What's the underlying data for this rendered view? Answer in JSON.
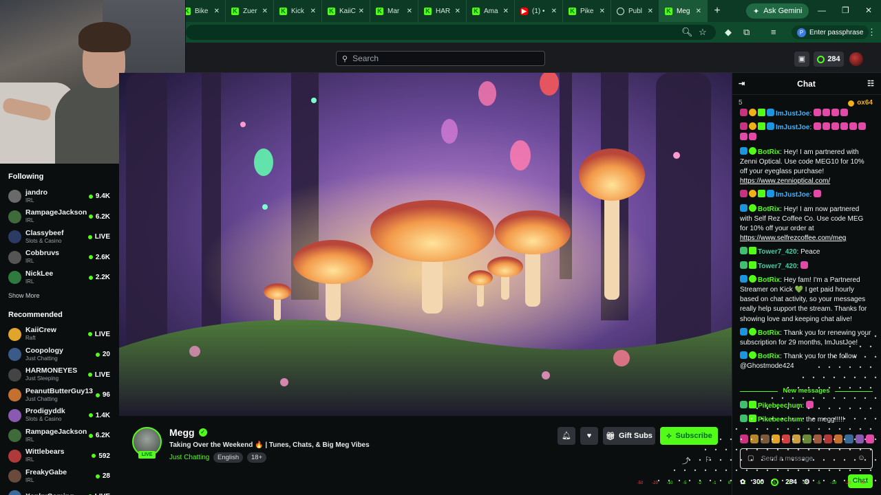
{
  "browser": {
    "tabs": [
      {
        "label": "Bike",
        "icon": "kick-icon"
      },
      {
        "label": "Zuer",
        "icon": "kick-icon"
      },
      {
        "label": "Kick",
        "icon": "kick-icon"
      },
      {
        "label": "KaiiC",
        "icon": "kick-icon"
      },
      {
        "label": "Mar",
        "icon": "kick-icon"
      },
      {
        "label": "HAR",
        "icon": "kick-icon"
      },
      {
        "label": "Ama",
        "icon": "kick-icon"
      },
      {
        "label": "(1) •",
        "icon": "youtube-icon"
      },
      {
        "label": "Pike",
        "icon": "kick-icon"
      },
      {
        "label": "Publ",
        "icon": "globe-icon"
      },
      {
        "label": "Meg",
        "icon": "kick-icon",
        "active": true
      }
    ],
    "new_tab": "+",
    "gemini_label": "Ask Gemini",
    "passphrase_label": "Enter passphrase",
    "passphrase_initial": "P",
    "accent": "#0d3a24"
  },
  "header": {
    "search_placeholder": "Search",
    "kicks_count": "284"
  },
  "sidebar": {
    "following_title": "Following",
    "following": [
      {
        "name": "jandro",
        "category": "IRL",
        "viewers": "9.4K",
        "avatar": "#6a6a6a"
      },
      {
        "name": "RampageJackson",
        "category": "IRL",
        "viewers": "6.2K",
        "avatar": "#3f6b3a"
      },
      {
        "name": "Classybeef",
        "category": "Slots & Casino",
        "viewers": "LIVE",
        "avatar": "#2c3b66"
      },
      {
        "name": "Cobbruvs",
        "category": "IRL",
        "viewers": "2.6K",
        "avatar": "#555"
      },
      {
        "name": "NickLee",
        "category": "IRL",
        "viewers": "2.2K",
        "avatar": "#2f7a3f"
      }
    ],
    "show_more": "Show More",
    "recommended_title": "Recommended",
    "recommended": [
      {
        "name": "KaiiCrew",
        "category": "Raft",
        "viewers": "LIVE",
        "avatar": "#e0a52a"
      },
      {
        "name": "Coopology",
        "category": "Just Chatting",
        "viewers": "20",
        "avatar": "#3a5a8a"
      },
      {
        "name": "HARMONEYES",
        "category": "Just Sleeping",
        "viewers": "LIVE",
        "avatar": "#444"
      },
      {
        "name": "PeanutButterGuy13",
        "category": "Just Chatting",
        "viewers": "96",
        "avatar": "#c4702e"
      },
      {
        "name": "Prodigyddk",
        "category": "Slots & Casino",
        "viewers": "1.4K",
        "avatar": "#8a5ab0"
      },
      {
        "name": "RampageJackson",
        "category": "IRL",
        "viewers": "6.2K",
        "avatar": "#3f6b3a"
      },
      {
        "name": "Wittlebears",
        "category": "IRL",
        "viewers": "592",
        "avatar": "#b03a3a"
      },
      {
        "name": "FreakyGabe",
        "category": "IRL",
        "viewers": "28",
        "avatar": "#6a4a3a"
      },
      {
        "name": "XankuGaming",
        "category": "",
        "viewers": "LIVE",
        "avatar": "#3a6a9a"
      }
    ]
  },
  "stream": {
    "channel": "Megg",
    "live_badge": "LIVE",
    "title": "Taking Over the Weekend 🔥 | Tunes, Chats, & Big Meg Vibes",
    "category": "Just Chatting",
    "tags": [
      "English",
      "18+"
    ],
    "gift_subs_label": "Gift Subs",
    "subscribe_label": "Subscribe",
    "brand_color": "#53fc18"
  },
  "chat": {
    "title": "Chat",
    "pinned_count": "5",
    "pinned_user": "ox64",
    "messages": [
      {
        "user": "ImJustJoe",
        "color": "#3db2ff",
        "badges": [
          "sub",
          "coin",
          "gift",
          "bot"
        ],
        "text": "",
        "emotes": 4,
        "cut": true
      },
      {
        "user": "ImJustJoe",
        "color": "#3db2ff",
        "badges": [
          "sub",
          "coin",
          "gift",
          "bot"
        ],
        "text": "",
        "emotes": 8
      },
      {
        "user": "BotRix",
        "color": "#53fc18",
        "badges": [
          "bot",
          "ver"
        ],
        "text": "Hey! I am partnered with Zenni Optical. Use code MEG10 for 10% off your eyeglass purchase!",
        "link": "https://www.zennioptical.com/"
      },
      {
        "user": "ImJustJoe",
        "color": "#3db2ff",
        "badges": [
          "sub",
          "coin",
          "gift",
          "bot"
        ],
        "text": "",
        "emotes": 1
      },
      {
        "user": "BotRix",
        "color": "#53fc18",
        "badges": [
          "bot",
          "ver"
        ],
        "text": "Hey! I am now partnered with Self Rez Coffee Co. Use code MEG for 10% off your order at",
        "link": "https://www.selfrezcoffee.com/meg"
      },
      {
        "user": "Tower7_420",
        "color": "#3fd0a0",
        "badges": [
          "ten",
          "gift"
        ],
        "text": "Peace"
      },
      {
        "user": "Tower7_420",
        "color": "#3fd0a0",
        "badges": [
          "ten",
          "gift"
        ],
        "text": "",
        "emotes": 1
      },
      {
        "user": "BotRix",
        "color": "#53fc18",
        "badges": [
          "bot",
          "ver"
        ],
        "text": "Hey fam! I'm a Partnered Streamer on Kick 💚 I get paid hourly based on chat activity, so your messages really help support the stream. Thanks for showing love and keeping chat alive!"
      },
      {
        "user": "BotRix",
        "color": "#53fc18",
        "badges": [
          "bot",
          "ver"
        ],
        "text": "Thank you for renewing your subscription for 29 months, ImJustJoe!"
      },
      {
        "user": "BotRix",
        "color": "#53fc18",
        "badges": [
          "bot",
          "ver"
        ],
        "text": "Thank you for the follow @Ghostmode424"
      }
    ],
    "new_messages_label": "New messages",
    "new_messages": [
      {
        "user": "Pikebeechum",
        "color": "#53fc18",
        "badges": [
          "ten",
          "gift"
        ],
        "text": "",
        "emotes": 1
      },
      {
        "user": "Pikebeechum",
        "color": "#53fc18",
        "badges": [
          "ten",
          "gift"
        ],
        "text": "the megg!!!!!"
      }
    ],
    "input_placeholder": "Send a message",
    "points": "300",
    "kicks": "284",
    "chat_button": "Chat"
  },
  "meters": [
    "-50",
    "-20",
    "-10",
    "-5",
    "-2",
    "-1",
    "0",
    "-1",
    "-2",
    "-5",
    "-1",
    "-2",
    "-5",
    "-10",
    "-20",
    "-50"
  ]
}
